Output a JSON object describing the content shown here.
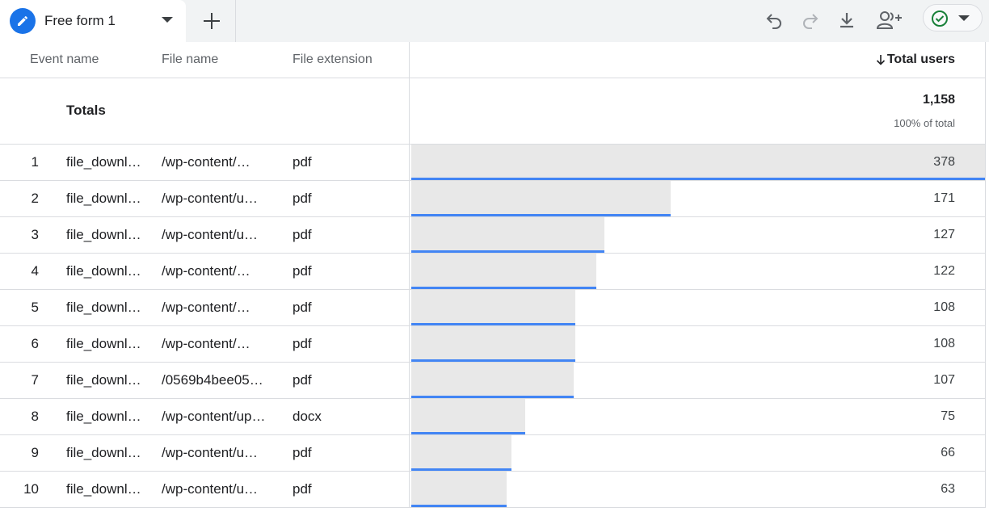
{
  "tab": {
    "title": "Free form 1",
    "icon": "pencil-icon"
  },
  "toolbar": {
    "add_tab_icon": "plus-icon",
    "undo_icon": "undo-icon",
    "redo_icon": "redo-icon",
    "download_icon": "download-icon",
    "share_icon": "share-users-icon",
    "status_icon": "check-circle-icon"
  },
  "colors": {
    "accent": "#1a73e8",
    "bar_fill": "#e8e8e8",
    "bar_line": "#4285f4",
    "status_green": "#188038"
  },
  "table": {
    "headers": {
      "event_name": "Event name",
      "file_name": "File name",
      "file_extension": "File extension",
      "metric": "Total users",
      "metric_sort_icon": "arrow-down-icon"
    },
    "totals": {
      "label": "Totals",
      "value": "1,158",
      "percent": "100% of total"
    },
    "rows": [
      {
        "index": "1",
        "event": "file_downl…",
        "file": "/wp-content/…",
        "ext": "pdf",
        "users": "378",
        "value": 378
      },
      {
        "index": "2",
        "event": "file_downl…",
        "file": "/wp-content/u…",
        "ext": "pdf",
        "users": "171",
        "value": 171
      },
      {
        "index": "3",
        "event": "file_downl…",
        "file": "/wp-content/u…",
        "ext": "pdf",
        "users": "127",
        "value": 127
      },
      {
        "index": "4",
        "event": "file_downl…",
        "file": "/wp-content/…",
        "ext": "pdf",
        "users": "122",
        "value": 122
      },
      {
        "index": "5",
        "event": "file_downl…",
        "file": "/wp-content/…",
        "ext": "pdf",
        "users": "108",
        "value": 108
      },
      {
        "index": "6",
        "event": "file_downl…",
        "file": "/wp-content/…",
        "ext": "pdf",
        "users": "108",
        "value": 108
      },
      {
        "index": "7",
        "event": "file_downl…",
        "file": "/0569b4bee05…",
        "ext": "pdf",
        "users": "107",
        "value": 107
      },
      {
        "index": "8",
        "event": "file_downl…",
        "file": "/wp-content/up…",
        "ext": "docx",
        "users": "75",
        "value": 75
      },
      {
        "index": "9",
        "event": "file_downl…",
        "file": "/wp-content/u…",
        "ext": "pdf",
        "users": "66",
        "value": 66
      },
      {
        "index": "10",
        "event": "file_downl…",
        "file": "/wp-content/u…",
        "ext": "pdf",
        "users": "63",
        "value": 63
      }
    ]
  }
}
